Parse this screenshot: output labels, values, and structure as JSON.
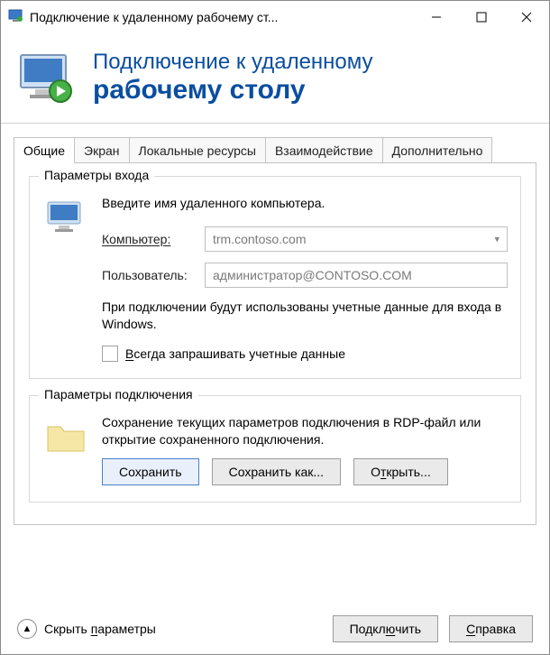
{
  "titlebar": {
    "title": "Подключение к удаленному рабочему ст..."
  },
  "banner": {
    "line1": "Подключение к удаленному",
    "line2": "рабочему столу"
  },
  "tabs": {
    "general": "Общие",
    "display": "Экран",
    "local": "Локальные ресурсы",
    "experience": "Взаимодействие",
    "advanced": "Дополнительно"
  },
  "login_group": {
    "title": "Параметры входа",
    "prompt": "Введите имя удаленного компьютера.",
    "computer_label": "Компьютер:",
    "computer_value": "trm.contoso.com",
    "user_label": "Пользователь:",
    "user_value": "администратор@CONTOSO.COM",
    "info": "При подключении будут использованы учетные данные для входа в Windows.",
    "always_ask": "Всегда запрашивать учетные данные"
  },
  "conn_group": {
    "title": "Параметры подключения",
    "info": "Сохранение текущих параметров подключения в RDP-файл или открытие сохраненного подключения.",
    "save": "Сохранить",
    "save_as": "Сохранить как...",
    "open": "Открыть..."
  },
  "bottom": {
    "collapse": "Скрыть параметры",
    "connect": "Подключить",
    "help": "Справка"
  }
}
